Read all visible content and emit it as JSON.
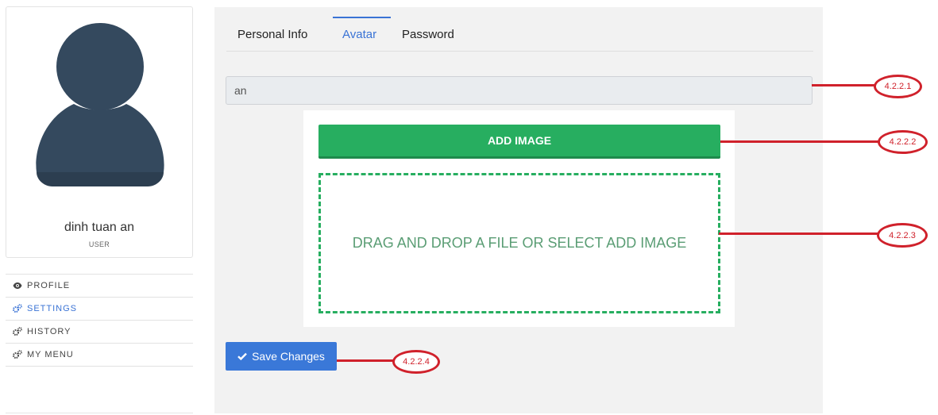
{
  "user": {
    "name": "dinh tuan an",
    "role": "USER"
  },
  "menu": {
    "items": [
      {
        "label": "PROFILE",
        "icon": "eye-icon"
      },
      {
        "label": "SETTINGS",
        "icon": "gears-icon",
        "active": true
      },
      {
        "label": "HISTORY",
        "icon": "gears-icon"
      },
      {
        "label": "MY MENU",
        "icon": "gears-icon"
      }
    ]
  },
  "tabs": [
    {
      "label": "Personal Info"
    },
    {
      "label": "Avatar",
      "active": true
    },
    {
      "label": "Password"
    }
  ],
  "form": {
    "name_value": "an",
    "add_image_label": "ADD IMAGE",
    "dropzone_text": "DRAG AND DROP A FILE OR SELECT ADD IMAGE",
    "save_label": "Save Changes"
  },
  "callouts": [
    {
      "label": "4.2.2.1"
    },
    {
      "label": "4.2.2.2"
    },
    {
      "label": "4.2.2.3"
    },
    {
      "label": "4.2.2.4"
    }
  ],
  "colors": {
    "accent_blue": "#3a73d5",
    "success_green": "#27ae60",
    "callout_red": "#d0212b",
    "avatar": "#34495e"
  }
}
